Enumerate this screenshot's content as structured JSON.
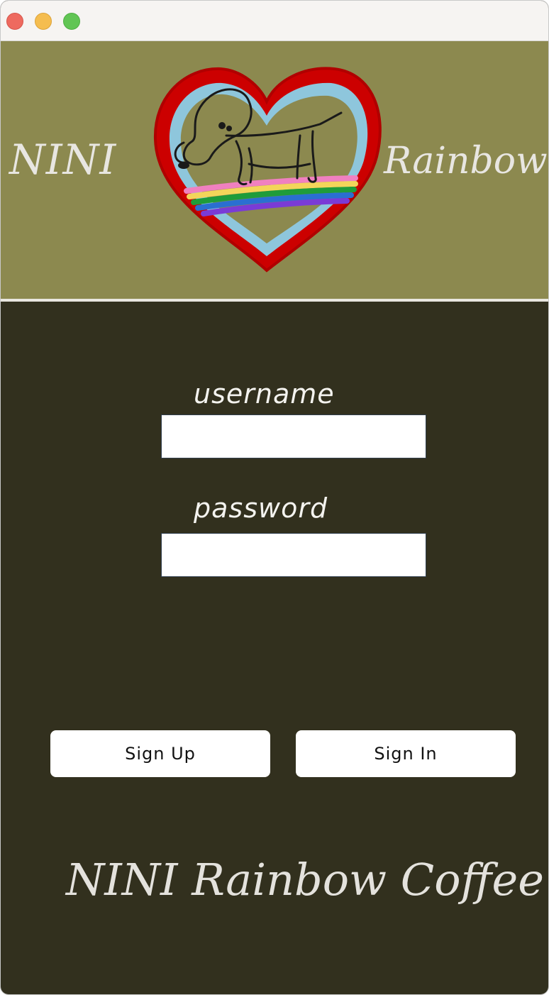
{
  "window": {
    "controls": [
      "close",
      "minimize",
      "maximize"
    ]
  },
  "header": {
    "left_text": "NINI",
    "right_text": "Rainbow",
    "logo_icon": "heart-dog-rainbow-logo"
  },
  "form": {
    "username_label": "username",
    "username_value": "",
    "password_label": "password",
    "password_value": ""
  },
  "actions": {
    "signup_label": "Sign Up",
    "signin_label": "Sign In"
  },
  "footer": {
    "text": "NINI Rainbow Coffee"
  },
  "colors": {
    "header_bg": "#8c894f",
    "body_bg": "#32301e",
    "heart_outer": "#cc0000",
    "heart_inner": "#8ec6dc"
  }
}
